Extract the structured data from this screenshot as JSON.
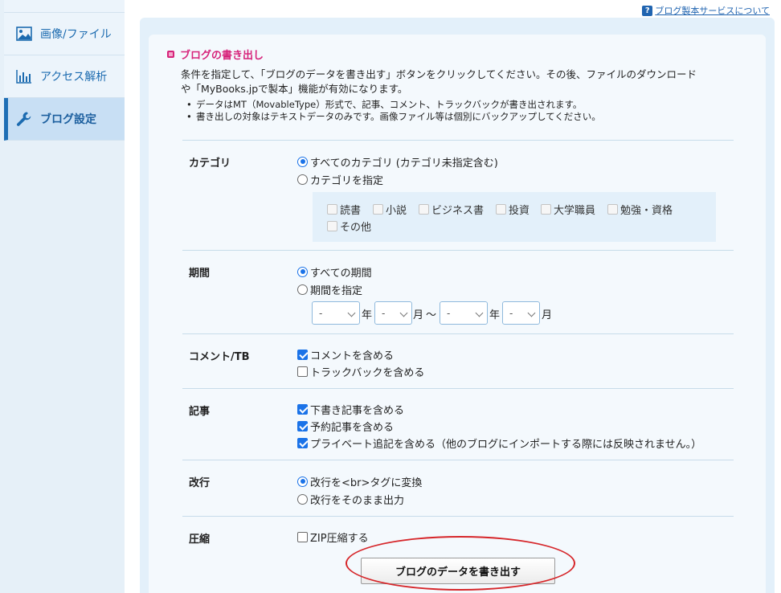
{
  "sidebar": {
    "items": [
      {
        "label": "画像/ファイル",
        "icon": "image-icon"
      },
      {
        "label": "アクセス解析",
        "icon": "bar-chart-icon"
      },
      {
        "label": "ブログ設定",
        "icon": "wrench-icon",
        "active": true
      }
    ]
  },
  "header": {
    "help_link": "ブログ製本サービスについて",
    "help_icon": "question-icon"
  },
  "section": {
    "title": "ブログの書き出し",
    "desc_line1": "条件を指定して、「ブログのデータを書き出す」ボタンをクリックしてください。その後、ファイルのダウンロード",
    "desc_line2": "や「MyBooks.jpで製本」機能が有効になります。",
    "bullet1": "データはMT（MovableType）形式で、記事、コメント、トラックバックが書き出されます。",
    "bullet2": "書き出しの対象はテキストデータのみです。画像ファイル等は個別にバックアップしてください。"
  },
  "category": {
    "label": "カテゴリ",
    "all": "すべてのカテゴリ (カテゴリ未指定含む)",
    "specify": "カテゴリを指定",
    "options": [
      "読書",
      "小説",
      "ビジネス書",
      "投資",
      "大学職員",
      "勉強・資格",
      "その他"
    ]
  },
  "period": {
    "label": "期間",
    "all": "すべての期間",
    "specify": "期間を指定",
    "select_placeholder": "-",
    "unit_year": "年",
    "unit_month": "月",
    "tilde": "〜"
  },
  "comment_tb": {
    "label": "コメント/TB",
    "comments": "コメントを含める",
    "trackbacks": "トラックバックを含める"
  },
  "articles": {
    "label": "記事",
    "drafts": "下書き記事を含める",
    "scheduled": "予約記事を含める",
    "private": "プライベート追記を含める（他のブログにインポートする際には反映されません。）"
  },
  "linebreak": {
    "label": "改行",
    "convert": "改行を<br>タグに変換",
    "asis": "改行をそのまま出力"
  },
  "compress": {
    "label": "圧縮",
    "zip": "ZIP圧縮する"
  },
  "submit_label": "ブログのデータを書き出す",
  "colors": {
    "accent": "#1f6fb5",
    "title_pink": "#d6237a",
    "highlight_red": "#d6262a"
  }
}
